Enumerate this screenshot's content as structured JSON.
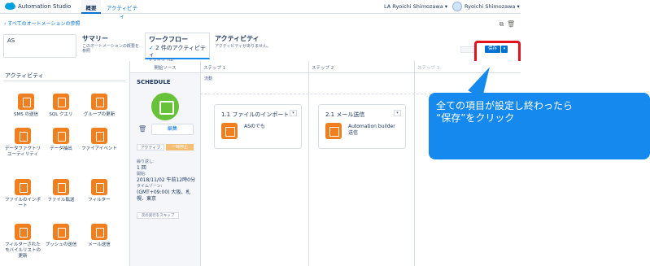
{
  "app": {
    "title": "Automation Studio"
  },
  "tabs": [
    {
      "label": "概要",
      "active": true
    },
    {
      "label": "アクティビティ",
      "active": false
    }
  ],
  "user": {
    "business_unit": "LA Ryoichi Shimozawa",
    "name": "Ryoichi Shimozawa"
  },
  "back_link": "すべてのオートメーションの参照",
  "automation_name": "AS",
  "summary": {
    "title": "サマリー",
    "subtitle": "このオートメーションの概要を参照"
  },
  "workflow": {
    "title": "ワークフロー",
    "check_text": "2 件のアクティビティ",
    "sub": "2 ステップ中"
  },
  "activity_head": {
    "title": "アクティビティ",
    "subtitle": "アクティビティがありません。"
  },
  "save_label": "保存",
  "left_panel": {
    "title": "アクティビティ",
    "items": [
      {
        "label": "SMS の送信"
      },
      {
        "label": "SQL クエリ"
      },
      {
        "label": "グループの更新"
      },
      {
        "label": "データファクトリユーティリティ"
      },
      {
        "label": "データ抽出"
      },
      {
        "label": "ファイアイベント"
      },
      {
        "label": "ファイルのインポート"
      },
      {
        "label": "ファイル転送"
      },
      {
        "label": "フィルター"
      },
      {
        "label": "フィルターされたモバイルリストの更新"
      },
      {
        "label": "プッシュの送信"
      },
      {
        "label": "メール送信"
      }
    ]
  },
  "canvas": {
    "source_head": "開始ソース",
    "step1_head": "ステップ 1",
    "step2_head": "ステップ 2",
    "step3_head": "ステップ 3",
    "step1_sub": "流動",
    "schedule_title": "SCHEDULE",
    "edit_label": "編集",
    "toggle_active": "アクティブ",
    "toggle_paused": "一時停止",
    "repeat_key": "繰り返し:",
    "repeat_val": "1 回",
    "start_key": "開始:",
    "start_val": "2018/11/02 午前12時0分",
    "tz_key": "タイムゾーン:",
    "tz_val": "(GMT+09:00) 大阪、札幌、東京",
    "skip_label": "次の実行をスキップ",
    "card1": {
      "title": "1.1 ファイルのインポート",
      "text": "ASのでも"
    },
    "card2": {
      "title": "2.1 メール送信",
      "text1": "Automation builder",
      "text2": "送信"
    }
  },
  "callout": {
    "line1": "全ての項目が設定し終わったら",
    "line2": "“保存”をクリック"
  },
  "colors": {
    "accent": "#0070d2",
    "orange": "#f0801f",
    "callout": "#1589ee",
    "highlight": "#e3121b",
    "schedule": "#67c23a"
  }
}
